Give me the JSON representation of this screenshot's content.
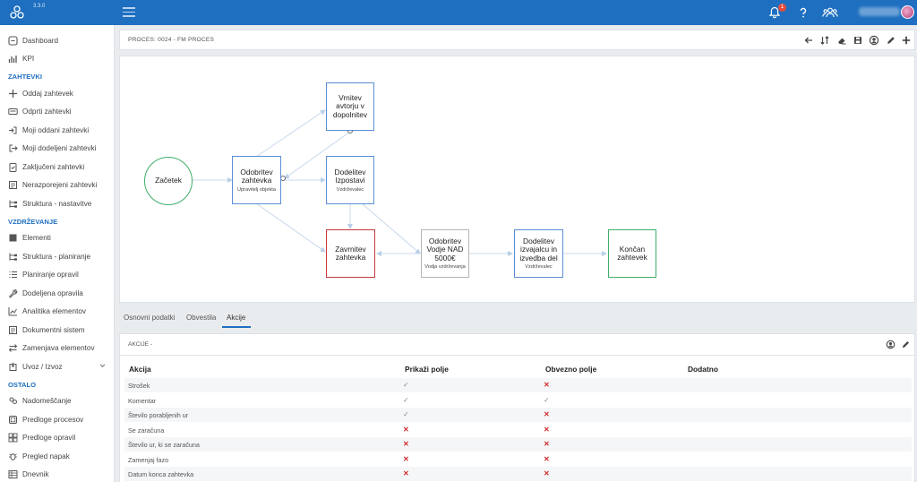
{
  "app": {
    "version": "3.3.0",
    "notification_count": "1",
    "colors": {
      "topbar": "#1e6fc0",
      "accent": "#1e6fc0",
      "danger": "#d22b2b"
    }
  },
  "sidebar": {
    "items": [
      {
        "label": "Dashboard",
        "icon": "dashboard-icon"
      },
      {
        "label": "KPI",
        "icon": "kpi-chart-icon"
      },
      {
        "section": "ZAHTEVKI"
      },
      {
        "label": "Oddaj zahtevek",
        "icon": "plus-icon"
      },
      {
        "label": "Odprti zahtevki",
        "icon": "keyboard-icon"
      },
      {
        "label": "Moji oddani zahtevki",
        "icon": "sign-in-icon"
      },
      {
        "label": "Moji dodeljeni zahtevki",
        "icon": "sign-out-icon"
      },
      {
        "label": "Zaključeni zahtevki",
        "icon": "clipboard-check-icon"
      },
      {
        "label": "Nerazporejeni zahtevki",
        "icon": "document-icon"
      },
      {
        "label": "Struktura - nastavitve",
        "icon": "sitemap-icon"
      },
      {
        "section": "VZDRŽEVANJE"
      },
      {
        "label": "Elementi",
        "icon": "cube-icon"
      },
      {
        "label": "Struktura - planiranje",
        "icon": "sitemap-icon"
      },
      {
        "label": "Planiranje opravil",
        "icon": "list-icon"
      },
      {
        "label": "Dodeljena opravila",
        "icon": "wrench-icon"
      },
      {
        "label": "Analitika elementov",
        "icon": "analytics-icon"
      },
      {
        "label": "Dokumentni sistem",
        "icon": "document-icon"
      },
      {
        "label": "Zamenjava elementov",
        "icon": "swap-icon"
      },
      {
        "label": "Uvoz / Izvoz",
        "icon": "import-export-icon",
        "chevron": true
      },
      {
        "section": "OSTALO"
      },
      {
        "label": "Nadomeščanje",
        "icon": "users-swap-icon"
      },
      {
        "label": "Predloge procesov",
        "icon": "template-icon"
      },
      {
        "label": "Predloge opravil",
        "icon": "grid-icon"
      },
      {
        "label": "Pregled napak",
        "icon": "bug-icon"
      },
      {
        "label": "Dnevnik",
        "icon": "table-icon"
      }
    ]
  },
  "header": {
    "title": "PROCES: 0024 - FM PROCES",
    "toolbar_icons": [
      "arrow-left-icon",
      "sort-icon",
      "eraser-icon",
      "save-icon",
      "user-icon",
      "pencil-icon",
      "plus-icon"
    ]
  },
  "diagram": {
    "nodes": [
      {
        "id": "start",
        "title": "Začetek",
        "subtitle": ""
      },
      {
        "id": "odobritev",
        "title": "Odobritev zahtevka",
        "subtitle": "Upravitelj objekta"
      },
      {
        "id": "vrnitev",
        "title": "Vrnitev avtorju v dopolnitev",
        "subtitle": ""
      },
      {
        "id": "dodelitev_izpostavi",
        "title": "Dodelitev Izpostavi",
        "subtitle": "Vzdrževalec"
      },
      {
        "id": "zavrnitev",
        "title": "Zavrnitev zahtevka",
        "subtitle": ""
      },
      {
        "id": "odobritev_vodje",
        "title": "Odobritev Vodje NAD 5000€",
        "subtitle": "Vodja vzdrževanja"
      },
      {
        "id": "dodelitev_izvajalcu",
        "title": "Dodelitev izvajalcu in izvedba del",
        "subtitle": "Vzdrževalec"
      },
      {
        "id": "end",
        "title": "Končan zahtevek",
        "subtitle": ""
      }
    ],
    "colors": {
      "start": "#3fae6a",
      "task": "#5b8dd6",
      "reject": "#c9383a",
      "neutral": "#b5b5b5",
      "end": "#3fae6a"
    }
  },
  "tabs": [
    {
      "label": "Osnovni podatki"
    },
    {
      "label": "Obvestila"
    },
    {
      "label": "Akcije",
      "active": true
    }
  ],
  "actions": {
    "title": "AKCIJE -",
    "columns": [
      "Akcija",
      "Prikaži polje",
      "Obvezno polje",
      "Dodatno"
    ],
    "rows": [
      {
        "name": "Strošek",
        "show": true,
        "required": false
      },
      {
        "name": "Komentar",
        "show": true,
        "required": true
      },
      {
        "name": "Število porabljenih ur",
        "show": true,
        "required": false
      },
      {
        "name": "Se zaračuna",
        "show": false,
        "required": false
      },
      {
        "name": "Število ur, ki se zaračuna",
        "show": false,
        "required": false
      },
      {
        "name": "Zamenjaj fazo",
        "show": false,
        "required": false
      },
      {
        "name": "Datum konca zahtevka",
        "show": false,
        "required": false
      }
    ]
  }
}
